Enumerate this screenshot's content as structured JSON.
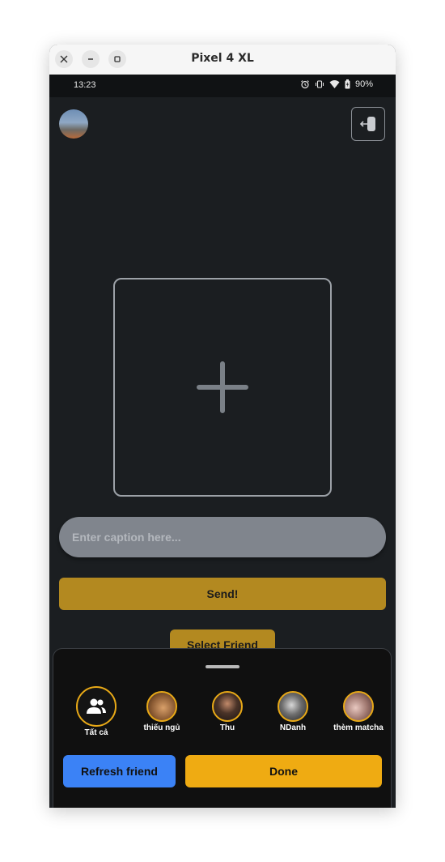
{
  "window": {
    "title": "Pixel 4 XL"
  },
  "status_bar": {
    "time": "13:23",
    "battery": "90%",
    "icons": [
      "alarm-icon",
      "vibrate-icon",
      "wifi-icon",
      "battery-charging-icon"
    ]
  },
  "main": {
    "caption_placeholder": "Enter caption here...",
    "send_label": "Send!",
    "select_friend_label": "Select Friend"
  },
  "sheet": {
    "friends": [
      {
        "name": "Tất cả",
        "icon": "group-icon",
        "selected": true
      },
      {
        "name": "thiếu ngủ"
      },
      {
        "name": "Thu"
      },
      {
        "name": "NDanh"
      },
      {
        "name": "thèm matcha"
      }
    ],
    "refresh_label": "Refresh friend",
    "done_label": "Done"
  },
  "colors": {
    "background": "#1b1e21",
    "gold": "#b38920",
    "done": "#efab12",
    "refresh": "#3b82f6",
    "caption_bg": "#80858d"
  }
}
